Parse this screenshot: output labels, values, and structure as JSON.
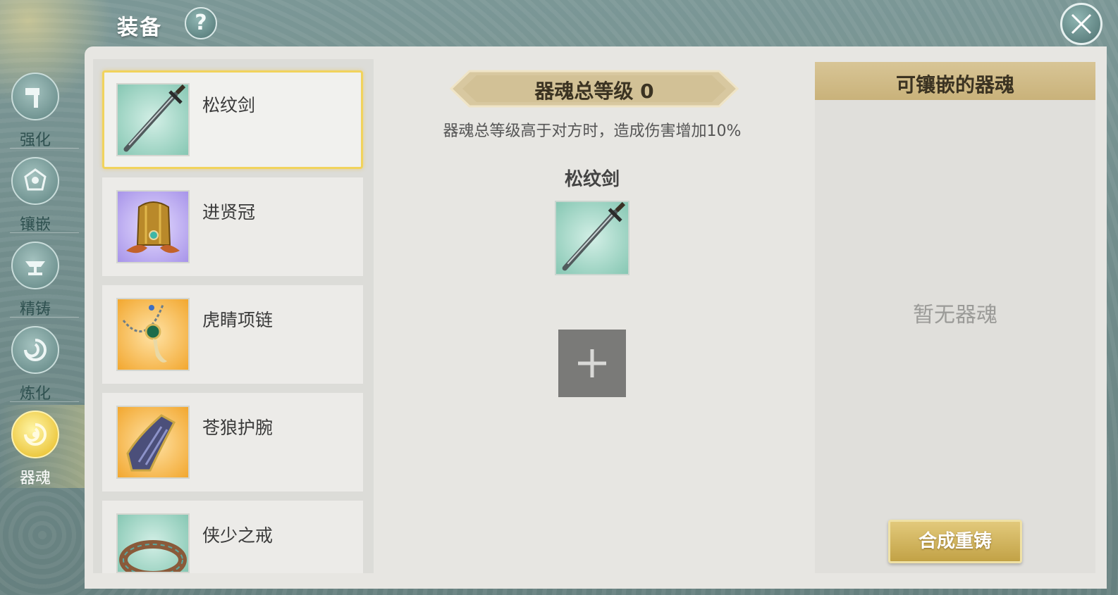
{
  "header": {
    "title": "装备",
    "help_label": "?"
  },
  "nav": {
    "items": [
      {
        "label": "强化",
        "icon": "hammer-icon",
        "active": false
      },
      {
        "label": "镶嵌",
        "icon": "gem-icon",
        "active": false
      },
      {
        "label": "精铸",
        "icon": "anvil-icon",
        "active": false
      },
      {
        "label": "炼化",
        "icon": "swirl-icon",
        "active": false
      },
      {
        "label": "器魂",
        "icon": "soul-swirl-icon",
        "active": true
      }
    ]
  },
  "equipment_list": [
    {
      "name": "松纹剑",
      "icon": "sword-icon",
      "selected": true
    },
    {
      "name": "进贤冠",
      "icon": "crown-hat-icon",
      "selected": false
    },
    {
      "name": "虎睛项链",
      "icon": "necklace-icon",
      "selected": false
    },
    {
      "name": "苍狼护腕",
      "icon": "bracer-icon",
      "selected": false
    },
    {
      "name": "侠少之戒",
      "icon": "ring-icon",
      "selected": false
    }
  ],
  "center": {
    "banner": "器魂总等级 0",
    "description": "器魂总等级高于对方时，造成伤害增加10%",
    "selected_item_name": "松纹剑",
    "add_slot_symbol": "+"
  },
  "right_panel": {
    "title": "可镶嵌的器魂",
    "empty_text": "暂无器魂",
    "button_label": "合成重铸"
  },
  "colors": {
    "accent_gold": "#f1d35c",
    "panel_bg": "#e7e6e2",
    "frame_teal": "#6f8d8c"
  }
}
